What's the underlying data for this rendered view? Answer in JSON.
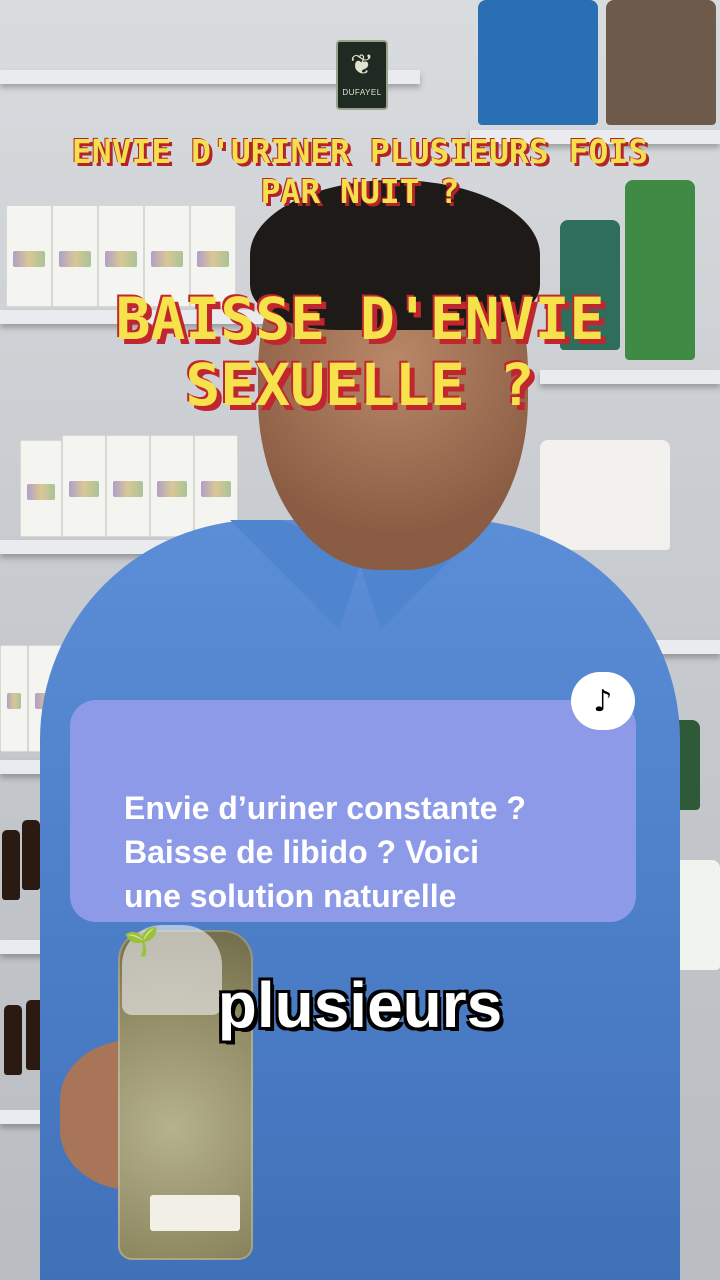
{
  "brand": {
    "logo_text": "DUFAYEL"
  },
  "overlay": {
    "caption_line1": "ENVIE D'URINER PLUSIEURS FOIS\nPAR NUIT ?",
    "caption_line2": "BAISSE D'ENVIE\nSEXUELLE ?"
  },
  "post": {
    "description": "Envie d’uriner constante ?\nBaisse de libido ? Voici\nune solution naturelle",
    "emoji_icon": "sprout-icon",
    "platform_icon": "tiktok-icon"
  },
  "subtitle": {
    "word": "plusieurs"
  },
  "colors": {
    "caption_yellow": "#f4e04d",
    "caption_red": "#b3232a",
    "card_bg": "#8f9be8",
    "shirt_blue": "#4a7cc6"
  }
}
